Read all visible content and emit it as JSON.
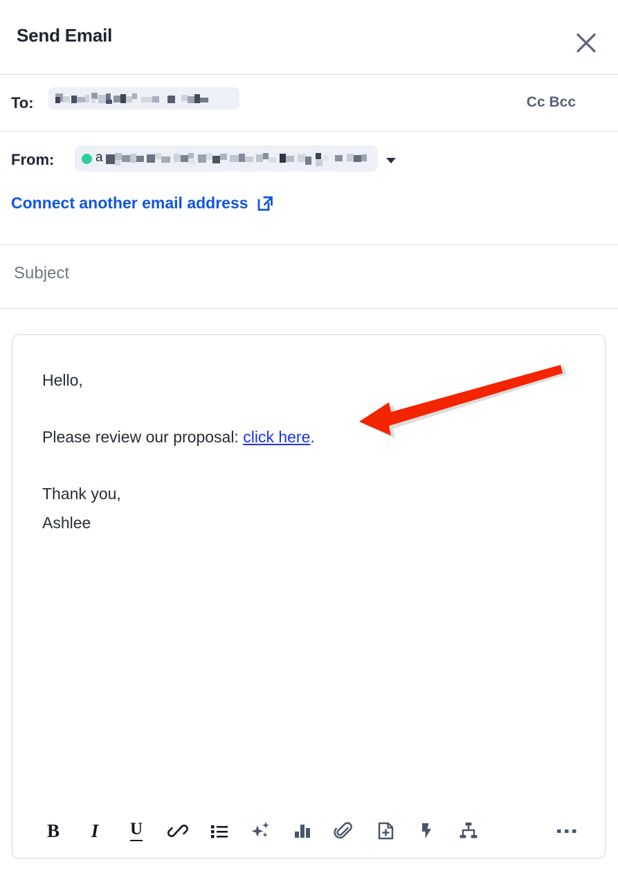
{
  "header": {
    "title": "Send Email",
    "close_icon": "close-icon"
  },
  "to_row": {
    "label": "To:",
    "recipient_value": "",
    "recipient_redacted": true,
    "cc_bcc_label": "Cc Bcc"
  },
  "from_row": {
    "label": "From:",
    "status_color": "#2fcf9b",
    "address_visible_prefix": "a",
    "address_redacted": true,
    "caret_icon": "chevron-down-icon",
    "connect_link_label": "Connect another email address",
    "connect_link_icon": "external-link-icon",
    "connect_link_color": "#1155dd"
  },
  "subject": {
    "placeholder": "Subject",
    "value": ""
  },
  "body": {
    "greeting": "Hello,",
    "line_prefix": "Please review our proposal: ",
    "link_text": "click here",
    "line_suffix": ".",
    "closing": "Thank you,",
    "signature": "Ashlee",
    "link_color": "#1a33ee"
  },
  "annotation": {
    "arrow_color": "#f32400",
    "points_to": "click here"
  },
  "toolbar": {
    "items": [
      {
        "name": "bold-button",
        "label": "B",
        "icon": "bold-icon"
      },
      {
        "name": "italic-button",
        "label": "I",
        "icon": "italic-icon"
      },
      {
        "name": "underline-button",
        "label": "U",
        "icon": "underline-icon"
      },
      {
        "name": "insert-link-button",
        "label": "",
        "icon": "link-icon"
      },
      {
        "name": "bulleted-list-button",
        "label": "",
        "icon": "bulleted-list-icon"
      },
      {
        "name": "ai-assist-button",
        "label": "",
        "icon": "sparkles-icon"
      },
      {
        "name": "insert-chart-button",
        "label": "",
        "icon": "bar-chart-icon"
      },
      {
        "name": "attach-file-button",
        "label": "",
        "icon": "paperclip-icon"
      },
      {
        "name": "insert-document-button",
        "label": "",
        "icon": "document-add-icon"
      },
      {
        "name": "quick-actions-button",
        "label": "",
        "icon": "lightning-bolt-icon"
      },
      {
        "name": "add-to-sequence-button",
        "label": "",
        "icon": "sequence-tree-icon"
      },
      {
        "name": "more-options-button",
        "label": "",
        "icon": "ellipsis-icon"
      }
    ]
  }
}
